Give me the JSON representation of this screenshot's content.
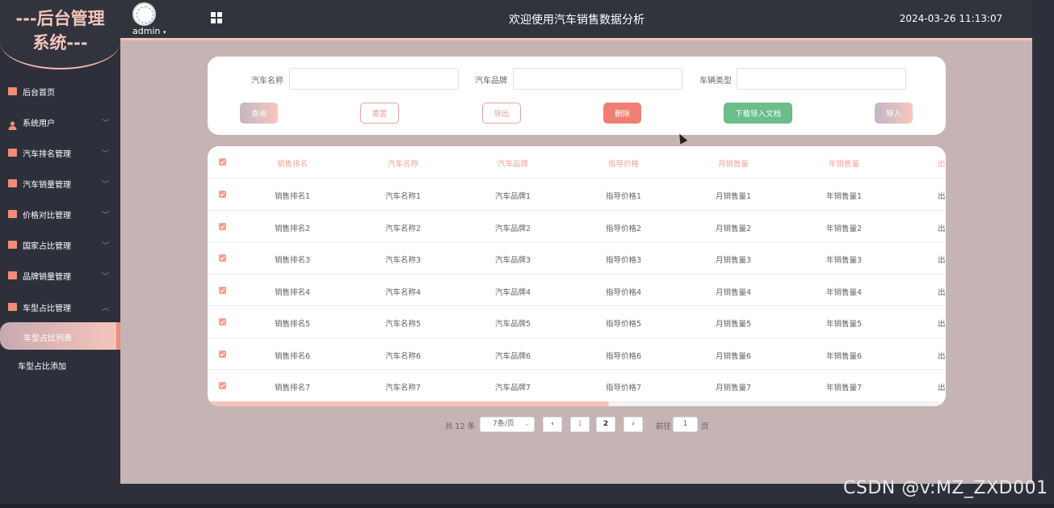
{
  "logo": {
    "line1": "---后台管理",
    "line2": "系统---"
  },
  "header": {
    "user": "admin",
    "title": "欢迎使用汽车销售数据分析",
    "datetime": "2024-03-26 11:13:07"
  },
  "sidebar": {
    "items": [
      {
        "label": "后台首页",
        "icon": "monitor-icon"
      },
      {
        "label": "系统用户",
        "icon": "user-icon"
      },
      {
        "label": "汽车排名管理",
        "icon": "chart-icon"
      },
      {
        "label": "汽车销量管理",
        "icon": "chart-icon"
      },
      {
        "label": "价格对比管理",
        "icon": "chart-icon"
      },
      {
        "label": "国家占比管理",
        "icon": "chart-icon"
      },
      {
        "label": "品牌销量管理",
        "icon": "chart-icon"
      },
      {
        "label": "车型占比管理",
        "icon": "chart-icon"
      }
    ],
    "submenu": [
      {
        "label": "车型占比列表",
        "active": true
      },
      {
        "label": "车型占比添加",
        "active": false
      }
    ]
  },
  "search": {
    "fields": [
      {
        "label": "汽车名称",
        "value": ""
      },
      {
        "label": "汽车品牌",
        "value": ""
      },
      {
        "label": "车辆类型",
        "value": ""
      }
    ],
    "buttons": {
      "query": "查询",
      "reset": "重置",
      "export": "导出",
      "delete": "删除",
      "download_template": "下载导入文档",
      "import": "导入"
    }
  },
  "table": {
    "headers": [
      "销售排名",
      "汽车名称",
      "汽车品牌",
      "指导价格",
      "月销售量",
      "年销售量",
      "出"
    ],
    "rows": [
      [
        "销售排名1",
        "汽车名称1",
        "汽车品牌1",
        "指导价格1",
        "月销售量1",
        "年销售量1",
        "出"
      ],
      [
        "销售排名2",
        "汽车名称2",
        "汽车品牌2",
        "指导价格2",
        "月销售量2",
        "年销售量2",
        "出"
      ],
      [
        "销售排名3",
        "汽车名称3",
        "汽车品牌3",
        "指导价格3",
        "月销售量3",
        "年销售量3",
        "出"
      ],
      [
        "销售排名4",
        "汽车名称4",
        "汽车品牌4",
        "指导价格4",
        "月销售量4",
        "年销售量4",
        "出"
      ],
      [
        "销售排名5",
        "汽车名称5",
        "汽车品牌5",
        "指导价格5",
        "月销售量5",
        "年销售量5",
        "出"
      ],
      [
        "销售排名6",
        "汽车名称6",
        "汽车品牌6",
        "指导价格6",
        "月销售量6",
        "年销售量6",
        "出"
      ],
      [
        "销售排名7",
        "汽车名称7",
        "汽车品牌7",
        "指导价格7",
        "月销售量7",
        "年销售量7",
        "出"
      ]
    ]
  },
  "pagination": {
    "total": "共 12 条",
    "page_size": "7条/页",
    "pages": [
      "1",
      "2"
    ],
    "current_page": "1",
    "goto_label": "前往",
    "goto_value": "1",
    "page_suffix": "页"
  },
  "watermark": "CSDN @v:MZ_ZXD001",
  "colors": {
    "sidebar_bg": "#2d303a",
    "main_bg": "#c6b3b3",
    "accent": "#f08c78",
    "header_text": "#f3a393",
    "delete": "#f07f73",
    "download": "#6bbd8a"
  }
}
